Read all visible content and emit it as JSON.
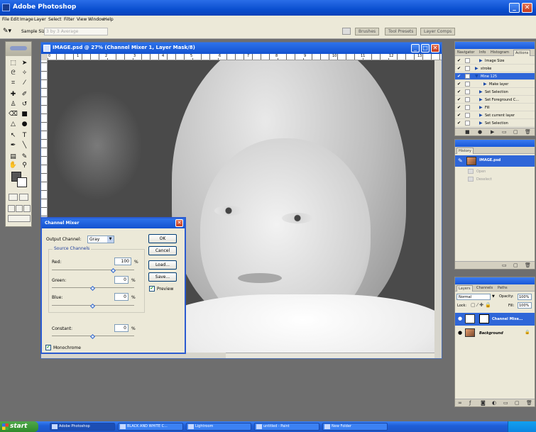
{
  "app": {
    "title": "Adobe Photoshop"
  },
  "menu": [
    "File",
    "Edit",
    "Image",
    "Layer",
    "Select",
    "Filter",
    "View",
    "Window",
    "Help"
  ],
  "options_bar": {
    "tool_icon": "eyedropper-icon",
    "sample_size_label": "Sample Size:",
    "sample_size_value": "3 by 3 Average",
    "well_tabs": [
      "Brushes",
      "Tool Presets",
      "Layer Comps"
    ]
  },
  "document": {
    "title": "IMAGE.psd @ 27% (Channel Mixer 1, Layer Mask/8)",
    "ruler_marks": [
      "0",
      "1",
      "2",
      "3",
      "4",
      "5",
      "6",
      "7",
      "8",
      "9",
      "10",
      "11",
      "12",
      "13"
    ]
  },
  "channel_mixer": {
    "title": "Channel Mixer",
    "output_channel_label": "Output Channel:",
    "output_channel_value": "Gray",
    "source_channels_label": "Source Channels",
    "red_label": "Red:",
    "red_value": "100",
    "red_percent": 1.0,
    "green_label": "Green:",
    "green_value": "0",
    "green_percent": 0.0,
    "blue_label": "Blue:",
    "blue_value": "0",
    "blue_percent": 0.0,
    "constant_label": "Constant:",
    "constant_value": "0",
    "constant_percent": 0.0,
    "percent_sign": "%",
    "monochrome_label": "Monochrome",
    "monochrome_checked": true,
    "ok_label": "OK",
    "cancel_label": "Cancel",
    "load_label": "Load...",
    "save_label": "Save...",
    "preview_label": "Preview",
    "preview_checked": true
  },
  "actions_panel": {
    "tabs": [
      "Navigator",
      "Info",
      "Histogram",
      "Actions"
    ],
    "active_tab": "Actions",
    "items": [
      {
        "label": "Image Size",
        "indent": 1,
        "selected": false
      },
      {
        "label": "stroke",
        "indent": 0,
        "selected": false
      },
      {
        "label": "Mine 125",
        "indent": 0,
        "selected": true
      },
      {
        "label": "Make layer",
        "indent": 2,
        "selected": false
      },
      {
        "label": "Set Selection",
        "indent": 1,
        "selected": false
      },
      {
        "label": "Set Foreground C...",
        "indent": 1,
        "selected": false
      },
      {
        "label": "Fill",
        "indent": 1,
        "selected": false
      },
      {
        "label": "Set current layer",
        "indent": 1,
        "selected": false
      },
      {
        "label": "Set Selection",
        "indent": 1,
        "selected": false
      }
    ]
  },
  "history_panel": {
    "tabs": [
      "History"
    ],
    "snapshot": "IMAGE.psd",
    "steps": [
      "Open",
      "Deselect"
    ]
  },
  "layers_panel": {
    "tabs": [
      "Layers",
      "Channels",
      "Paths"
    ],
    "blend_mode": "Normal",
    "opacity_label": "Opacity:",
    "opacity_value": "100%",
    "lock_label": "Lock:",
    "fill_label": "Fill:",
    "fill_value": "100%",
    "layers": [
      {
        "name": "Channel Mixe...",
        "selected": true
      },
      {
        "name": "Background",
        "selected": false
      }
    ]
  },
  "taskbar": {
    "start_label": "start",
    "tasks": [
      "Adobe Photoshop",
      "BLACK AND WHITE C...",
      "Lightroom",
      "untitled - Paint",
      "New Folder"
    ]
  },
  "colors": {
    "title_blue": "#0a4fd0",
    "panel_bg": "#ece9d8",
    "selection": "#2f66d8",
    "workspace": "#6e6e6e"
  }
}
